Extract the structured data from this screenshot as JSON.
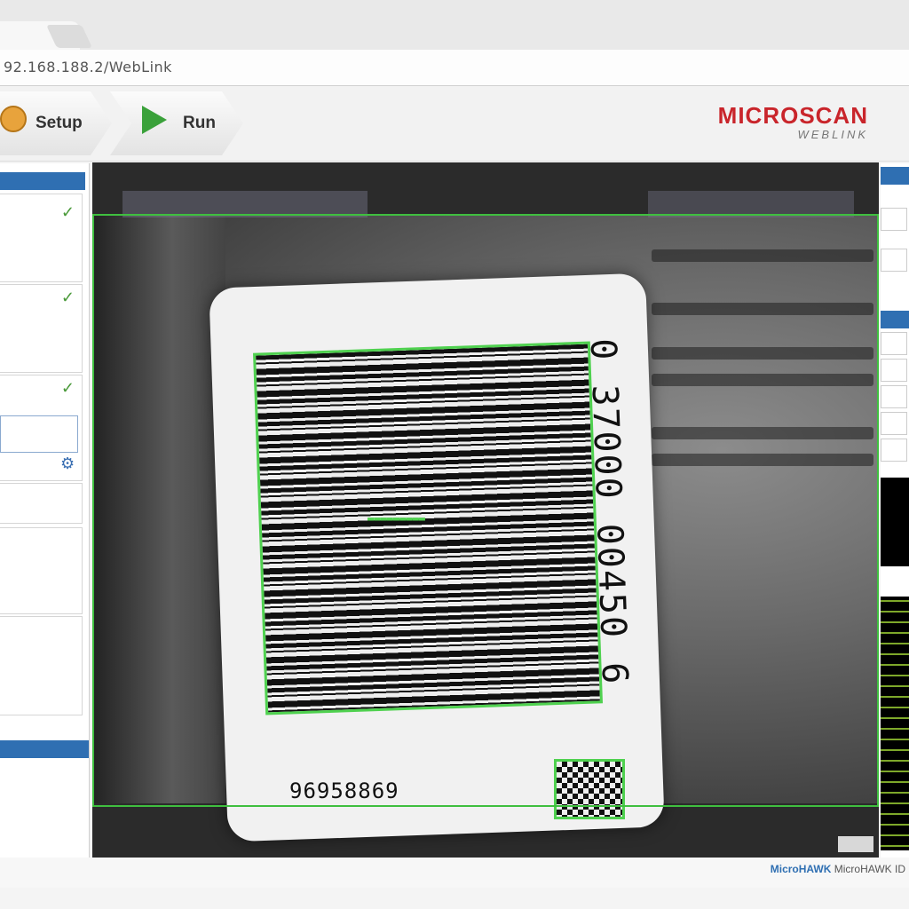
{
  "browser": {
    "tab_close_glyph": "×",
    "address_url": "92.168.188.2/WebLink"
  },
  "header": {
    "setup_label": "Setup",
    "run_label": "Run",
    "logo_main": "MICROSCAN",
    "logo_sub": "WEBLINK",
    "brand_color": "#c9252b"
  },
  "left_panel": {
    "check_glyph": "✓",
    "gear_glyph": "⚙"
  },
  "viewer": {
    "barcode_vertical_digits": "0 37000 00450 6",
    "label_number": "96958869",
    "decode_overlay_color": "#4fd14f"
  },
  "status_bar": {
    "product": "MicroHAWK",
    "version_text": "MicroHAWK ID"
  }
}
